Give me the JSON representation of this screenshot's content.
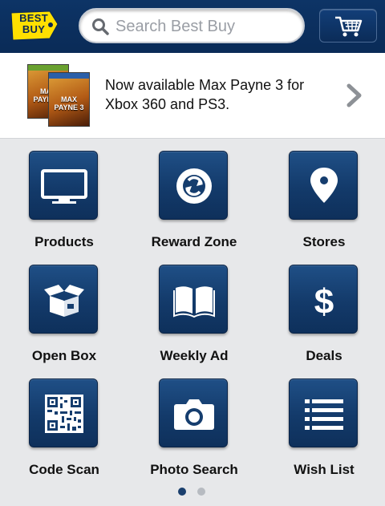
{
  "header": {
    "logo_text": "BEST BUY",
    "search_placeholder": "Search Best Buy",
    "cart_icon": "cart-icon"
  },
  "promo": {
    "text": "Now available Max Payne 3 for Xbox 360 and PS3.",
    "image_label": "MAX PAYNE 3",
    "chevron_icon": "chevron-right-icon"
  },
  "grid": {
    "items": [
      {
        "label": "Products",
        "icon": "monitor-icon"
      },
      {
        "label": "Reward Zone",
        "icon": "refresh-icon"
      },
      {
        "label": "Stores",
        "icon": "map-pin-icon"
      },
      {
        "label": "Open Box",
        "icon": "open-box-icon"
      },
      {
        "label": "Weekly Ad",
        "icon": "book-icon"
      },
      {
        "label": "Deals",
        "icon": "dollar-icon"
      },
      {
        "label": "Code Scan",
        "icon": "qr-code-icon"
      },
      {
        "label": "Photo Search",
        "icon": "camera-icon"
      },
      {
        "label": "Wish List",
        "icon": "list-icon"
      }
    ]
  },
  "pager": {
    "pages": 2,
    "current": 1
  },
  "colors": {
    "header": "#0d3466",
    "tile": "#133a6a",
    "logo_yellow": "#ffe000"
  }
}
